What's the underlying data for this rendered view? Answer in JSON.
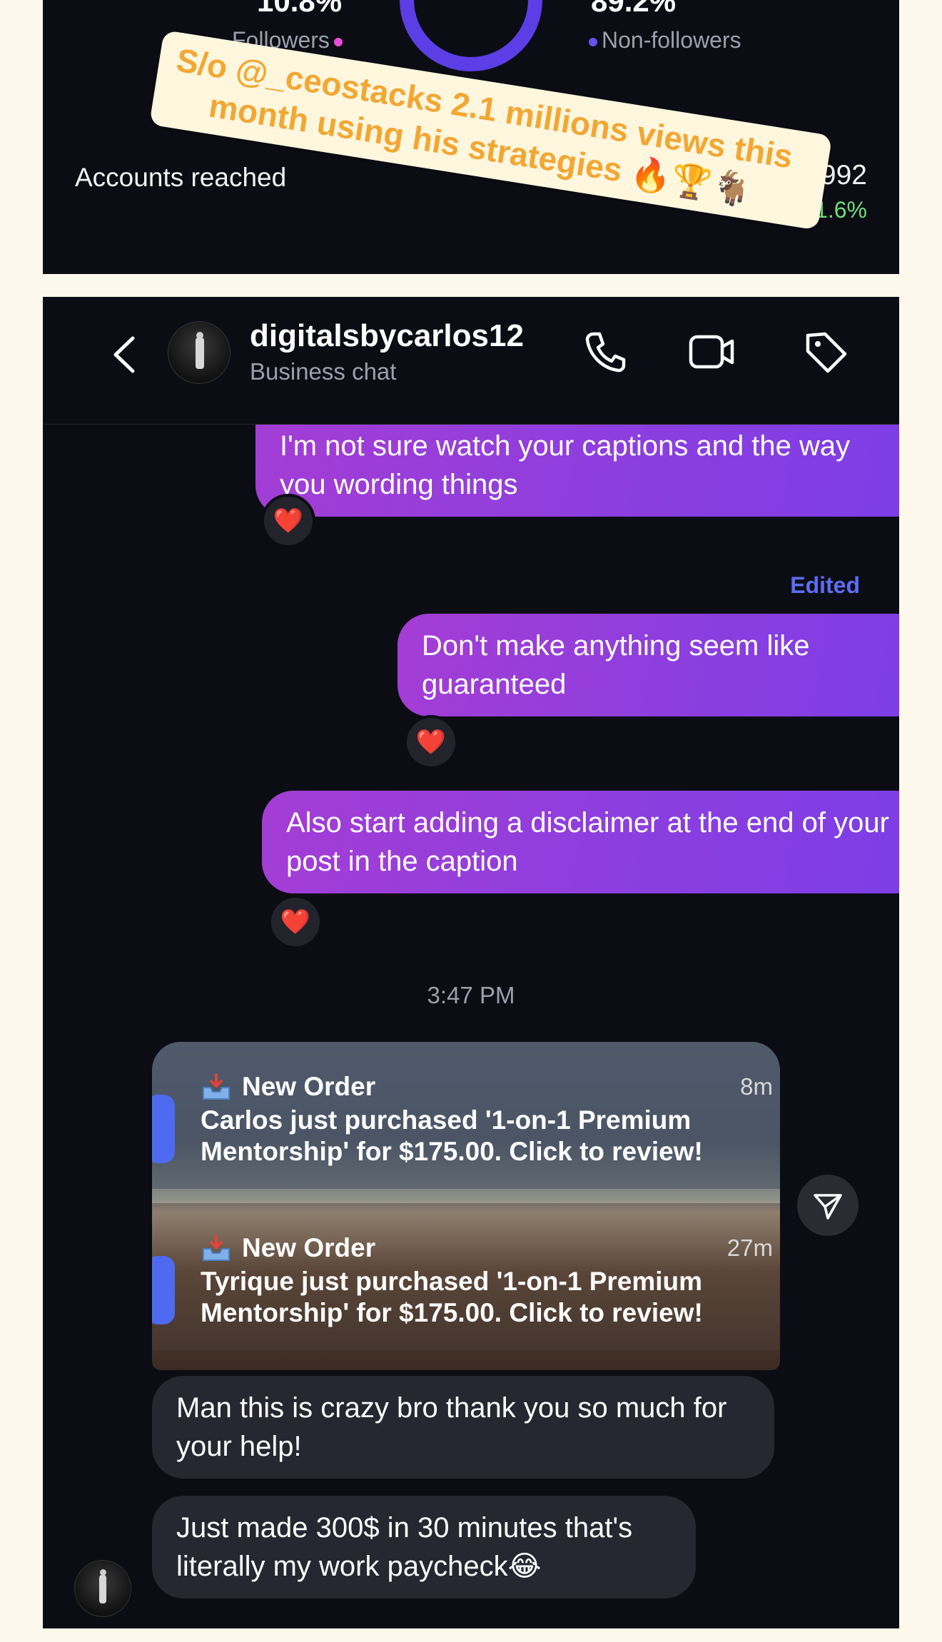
{
  "insights": {
    "followers_pct": "10.8%",
    "followers_label": "Followers",
    "non_followers_pct": "89.2%",
    "non_followers_label": "Non-followers",
    "accounts_reached_label": "Accounts reached",
    "accounts_reached_value": "045,992",
    "accounts_reached_change": "+51.6%",
    "followers_color": "#e84fd6",
    "non_followers_color": "#6a4ff0",
    "donut_color": "#5b3ee6"
  },
  "sticker": {
    "line1": "S/o @_ceostacks  2.1 millions views this",
    "line2": "month using his strategies 🔥🏆🐐"
  },
  "chat": {
    "username": "digitalsbycarlos12",
    "subtitle": "Business chat",
    "icons": [
      "back-icon",
      "phone-icon",
      "video-call-icon",
      "tag-icon"
    ],
    "messages": [
      {
        "direction": "out",
        "text": "I'm not sure watch your captions and the way you wording things",
        "reaction": "❤️"
      },
      {
        "direction": "out",
        "text": "Don't make anything seem like guaranteed",
        "reaction": "❤️",
        "edited_label": "Edited"
      },
      {
        "direction": "out",
        "text": "Also start adding a disclaimer at the end of your post in the caption",
        "reaction": "❤️"
      },
      {
        "direction": "in",
        "text": "Man this is crazy bro thank you so much for your help!"
      },
      {
        "direction": "in",
        "text": "Just made 300$ in 30 minutes that's literally my work paycheck😂"
      }
    ],
    "timestamp": "3:47 PM",
    "notifications": [
      {
        "title": "New Order",
        "time": "8m",
        "body": "Carlos just purchased '1-on-1 Premium Mentorship' for $175.00. Click to review!"
      },
      {
        "title": "New Order",
        "time": "27m",
        "body": "Tyrique just purchased '1-on-1 Premium Mentorship' for $175.00. Click to review!"
      }
    ],
    "accent_color": "#8a3ee0",
    "edited_color": "#5c6cf5"
  }
}
